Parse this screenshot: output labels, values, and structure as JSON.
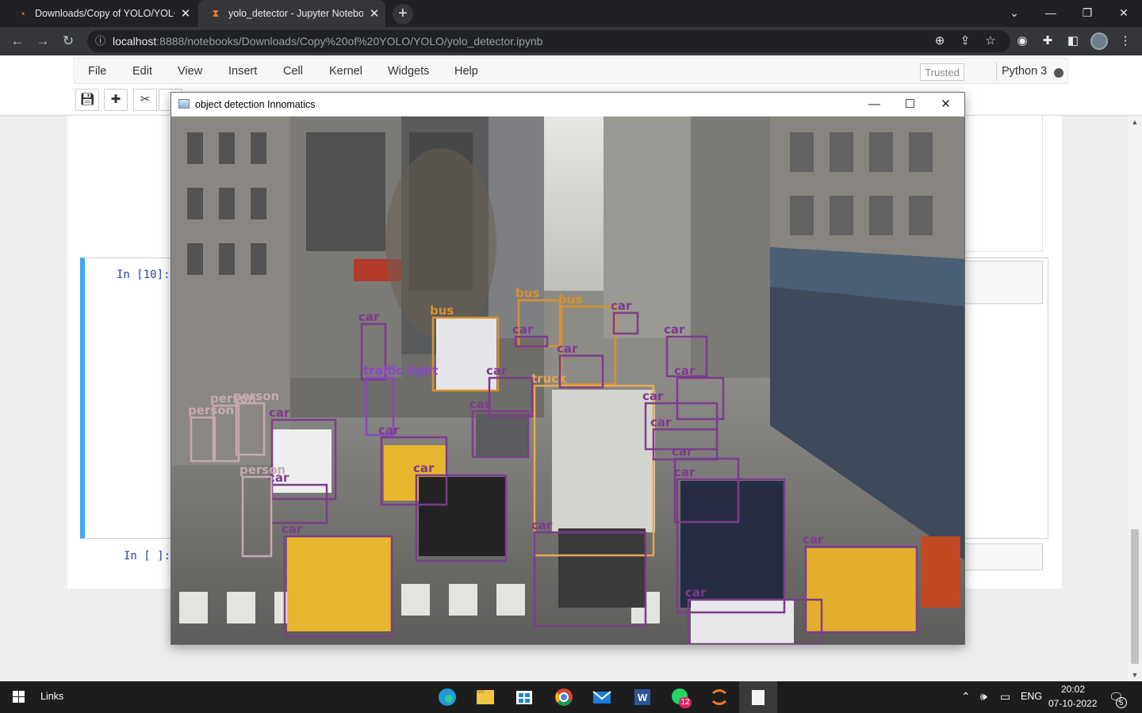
{
  "browser": {
    "tabs": [
      {
        "title": "Downloads/Copy of YOLO/YOLO",
        "close": "✕"
      },
      {
        "title": "yolo_detector - Jupyter Notebook",
        "close": "✕"
      }
    ],
    "new_tab": "+",
    "address": {
      "host": "localhost",
      "path": ":8888/notebooks/Downloads/Copy%20of%20YOLO/YOLO/yolo_detector.ipynb"
    }
  },
  "jupyter": {
    "menu": [
      "File",
      "Edit",
      "View",
      "Insert",
      "Cell",
      "Kernel",
      "Widgets",
      "Help"
    ],
    "trusted": "Trusted",
    "kernel": "Python 3",
    "cells": {
      "selected_prompt": "In [10]:",
      "empty_prompt": "In [ ]:"
    }
  },
  "cv_window": {
    "title": "object detection Innomatics",
    "detection_colors": {
      "car": "#7d3c8c",
      "bus": "#d8922a",
      "truck": "#e9a84a",
      "person": "#c7a9b2",
      "traffic_light": "#8b45c9"
    },
    "detections": [
      {
        "label": "bus",
        "class": "bus"
      },
      {
        "label": "bus",
        "class": "bus"
      },
      {
        "label": "bus",
        "class": "bus"
      },
      {
        "label": "truck",
        "class": "truck"
      },
      {
        "label": "car",
        "class": "car"
      },
      {
        "label": "car",
        "class": "car"
      },
      {
        "label": "car",
        "class": "car"
      },
      {
        "label": "car",
        "class": "car"
      },
      {
        "label": "car",
        "class": "car"
      },
      {
        "label": "car",
        "class": "car"
      },
      {
        "label": "car",
        "class": "car"
      },
      {
        "label": "car",
        "class": "car"
      },
      {
        "label": "car",
        "class": "car"
      },
      {
        "label": "car",
        "class": "car"
      },
      {
        "label": "car",
        "class": "car"
      },
      {
        "label": "car",
        "class": "car"
      },
      {
        "label": "car",
        "class": "car"
      },
      {
        "label": "car",
        "class": "car"
      },
      {
        "label": "car",
        "class": "car"
      },
      {
        "label": "car",
        "class": "car"
      },
      {
        "label": "car",
        "class": "car"
      },
      {
        "label": "car",
        "class": "car"
      },
      {
        "label": "car",
        "class": "car"
      },
      {
        "label": "car",
        "class": "car"
      },
      {
        "label": "traffic light",
        "class": "traffic_light"
      },
      {
        "label": "person",
        "class": "person"
      },
      {
        "label": "person",
        "class": "person"
      },
      {
        "label": "person",
        "class": "person"
      },
      {
        "label": "person",
        "class": "person"
      }
    ]
  },
  "taskbar": {
    "links": "Links",
    "lang": "ENG",
    "time": "20:02",
    "date": "07-10-2022",
    "whatsapp_badge": "12",
    "notification_count": "5"
  }
}
